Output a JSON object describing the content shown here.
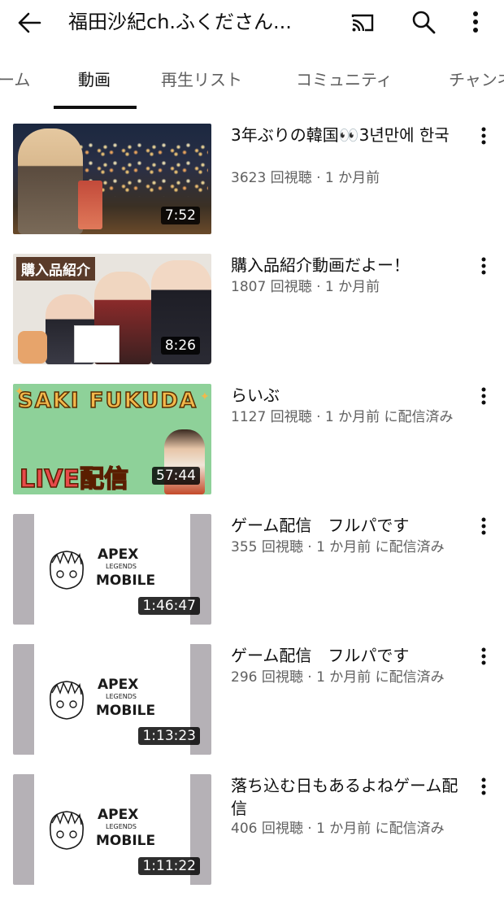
{
  "appbar": {
    "channel_title": "福田沙紀ch.ふくださん..."
  },
  "tabs": [
    {
      "label": "ーム"
    },
    {
      "label": "動画"
    },
    {
      "label": "再生リスト"
    },
    {
      "label": "コミュニティ"
    },
    {
      "label": "チャンネ"
    }
  ],
  "videos": [
    {
      "title": "3年ぶりの韓国👀3년만에 한국",
      "meta": "3623 回視聴 · 1 か月前",
      "duration": "7:52"
    },
    {
      "title": "購入品紹介動画だよー！",
      "meta": "1807 回視聴 · 1 か月前",
      "duration": "8:26",
      "thumb_text": "購入品紹介"
    },
    {
      "title": "らいぶ",
      "meta": "1127 回視聴 · 1 か月前 に配信済み",
      "duration": "57:44",
      "thumb_top": "SAKI FUKUDA",
      "thumb_bottom": "LIVE配信"
    },
    {
      "title": "ゲーム配信　フルパです",
      "meta": "355 回視聴 · 1 か月前 に配信済み",
      "duration": "1:46:47",
      "thumb_apex": "APEX",
      "thumb_legends": "LEGENDS",
      "thumb_mobile": "MOBILE"
    },
    {
      "title": "ゲーム配信　フルパです",
      "meta": "296 回視聴 · 1 か月前 に配信済み",
      "duration": "1:13:23",
      "thumb_apex": "APEX",
      "thumb_legends": "LEGENDS",
      "thumb_mobile": "MOBILE"
    },
    {
      "title": "落ち込む日もあるよねゲーム配信",
      "meta": "406 回視聴 · 1 か月前 に配信済み",
      "duration": "1:11:22",
      "thumb_apex": "APEX",
      "thumb_legends": "LEGENDS",
      "thumb_mobile": "MOBILE"
    }
  ],
  "icons": {
    "back": "back-arrow-icon",
    "cast": "cast-icon",
    "search": "search-icon",
    "more": "more-vert-icon"
  }
}
